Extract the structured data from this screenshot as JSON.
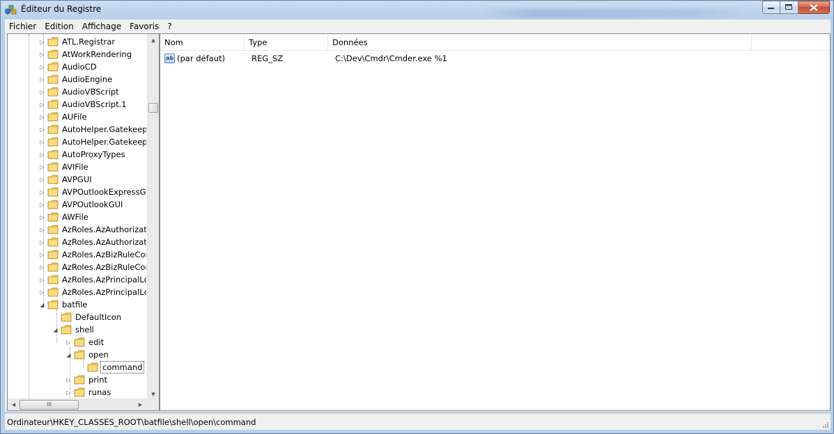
{
  "window": {
    "title": "Éditeur du Registre",
    "colors": {
      "frame": "#b7cfe9",
      "close": "#c44a30"
    }
  },
  "caption": {
    "minimize": "–",
    "maximize": "☐",
    "close": "✕"
  },
  "menu": {
    "items": [
      {
        "label": "Fichier"
      },
      {
        "label": "Edition"
      },
      {
        "label": "Affichage"
      },
      {
        "label": "Favoris"
      },
      {
        "label": "?"
      }
    ]
  },
  "tree": {
    "items": [
      {
        "label": "ATL.Registrar",
        "expander": "▷"
      },
      {
        "label": "AtWorkRendering",
        "expander": "▷"
      },
      {
        "label": "AudioCD",
        "expander": "▷"
      },
      {
        "label": "AudioEngine",
        "expander": "▷"
      },
      {
        "label": "AudioVBScript",
        "expander": "▷"
      },
      {
        "label": "AudioVBScript.1",
        "expander": "▷"
      },
      {
        "label": "AUFile",
        "expander": "▷"
      },
      {
        "label": "AutoHelper.Gatekeep",
        "expander": "▷"
      },
      {
        "label": "AutoHelper.Gatekeep",
        "expander": "▷"
      },
      {
        "label": "AutoProxyTypes",
        "expander": "▷"
      },
      {
        "label": "AVIFile",
        "expander": "▷"
      },
      {
        "label": "AVPGUI",
        "expander": "▷"
      },
      {
        "label": "AVPOutlookExpressGU",
        "expander": "▷"
      },
      {
        "label": "AVPOutlookGUI",
        "expander": "▷"
      },
      {
        "label": "AWFile",
        "expander": "▷"
      },
      {
        "label": "AzRoles.AzAuthorizati",
        "expander": "▷"
      },
      {
        "label": "AzRoles.AzAuthorizati",
        "expander": "▷"
      },
      {
        "label": "AzRoles.AzBizRuleCor",
        "expander": "▷"
      },
      {
        "label": "AzRoles.AzBizRuleCor",
        "expander": "▷"
      },
      {
        "label": "AzRoles.AzPrincipalLc",
        "expander": "▷"
      },
      {
        "label": "AzRoles.AzPrincipalLc",
        "expander": "▷"
      },
      {
        "label": "batfile",
        "expander": "◢"
      },
      {
        "label": "DefaultIcon",
        "expander": ""
      },
      {
        "label": "shell",
        "expander": "◢"
      },
      {
        "label": "edit",
        "expander": "▷"
      },
      {
        "label": "open",
        "expander": "◢"
      },
      {
        "label": "command",
        "expander": "",
        "selected": true
      },
      {
        "label": "print",
        "expander": "▷"
      },
      {
        "label": "runas",
        "expander": "▷"
      }
    ],
    "scroll": {
      "up": "▲",
      "down": "▼",
      "left": "◀",
      "right": "▶",
      "thumb_grip": "III"
    }
  },
  "list": {
    "columns": [
      {
        "label": "Nom"
      },
      {
        "label": "Type"
      },
      {
        "label": "Données"
      },
      {
        "label": ""
      }
    ],
    "rows": [
      {
        "icon": "string-value-icon",
        "icon_text": "ab",
        "name": "(par défaut)",
        "type": "REG_SZ",
        "data": "C:\\Dev\\Cmdr\\Cmder.exe %1"
      }
    ]
  },
  "status": {
    "path": "Ordinateur\\HKEY_CLASSES_ROOT\\batfile\\shell\\open\\command"
  }
}
